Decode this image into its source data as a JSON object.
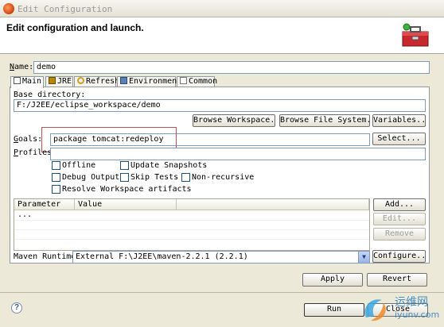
{
  "window": {
    "title": "Edit Configuration",
    "header_title": "Edit configuration and launch."
  },
  "name_field": {
    "label": "Name:",
    "value": "demo"
  },
  "tabs": [
    {
      "label": "Main",
      "icon": "main-tab-icon",
      "active": true
    },
    {
      "label": "JRE",
      "icon": "jre-tab-icon",
      "active": false
    },
    {
      "label": "Refresh",
      "icon": "refresh-tab-icon",
      "active": false
    },
    {
      "label": "Environment",
      "icon": "environment-tab-icon",
      "active": false
    },
    {
      "label": "Common",
      "icon": "common-tab-icon",
      "active": false
    }
  ],
  "base_directory": {
    "label": "Base directory:",
    "value": "F:/J2EE/eclipse_workspace/demo",
    "browse_workspace": "Browse Workspace...",
    "browse_file_system": "Browse File System...",
    "variables": "Variables..."
  },
  "goals": {
    "label": "Goals:",
    "value": "package tomcat:redeploy",
    "select": "Select..."
  },
  "profiles": {
    "label": "Profiles:",
    "value": ""
  },
  "options": [
    {
      "label": "Offline",
      "checked": false
    },
    {
      "label": "Update Snapshots",
      "checked": false
    },
    {
      "label": "Debug Output",
      "checked": false
    },
    {
      "label": "Skip Tests",
      "checked": false
    },
    {
      "label": "Non-recursive",
      "checked": false
    },
    {
      "label": "Resolve Workspace artifacts",
      "checked": false
    }
  ],
  "params_table": {
    "columns": [
      "Parameter ...",
      "Value"
    ],
    "add": "Add...",
    "edit": "Edit...",
    "remove": "Remove"
  },
  "maven_runtime": {
    "label": "Maven Runtime:",
    "value": "External F:\\J2EE\\maven-2.2.1 (2.2.1)",
    "configure": "Configure..."
  },
  "actions": {
    "apply": "Apply",
    "revert": "Revert",
    "run": "Run",
    "close": "Close"
  },
  "watermark": {
    "text_cn": "运维网",
    "text_en": "iyunv.com"
  },
  "colors": {
    "highlight": "#c0504d",
    "header_bg": "#ffffff",
    "dialog_bg": "#ece9d8"
  }
}
